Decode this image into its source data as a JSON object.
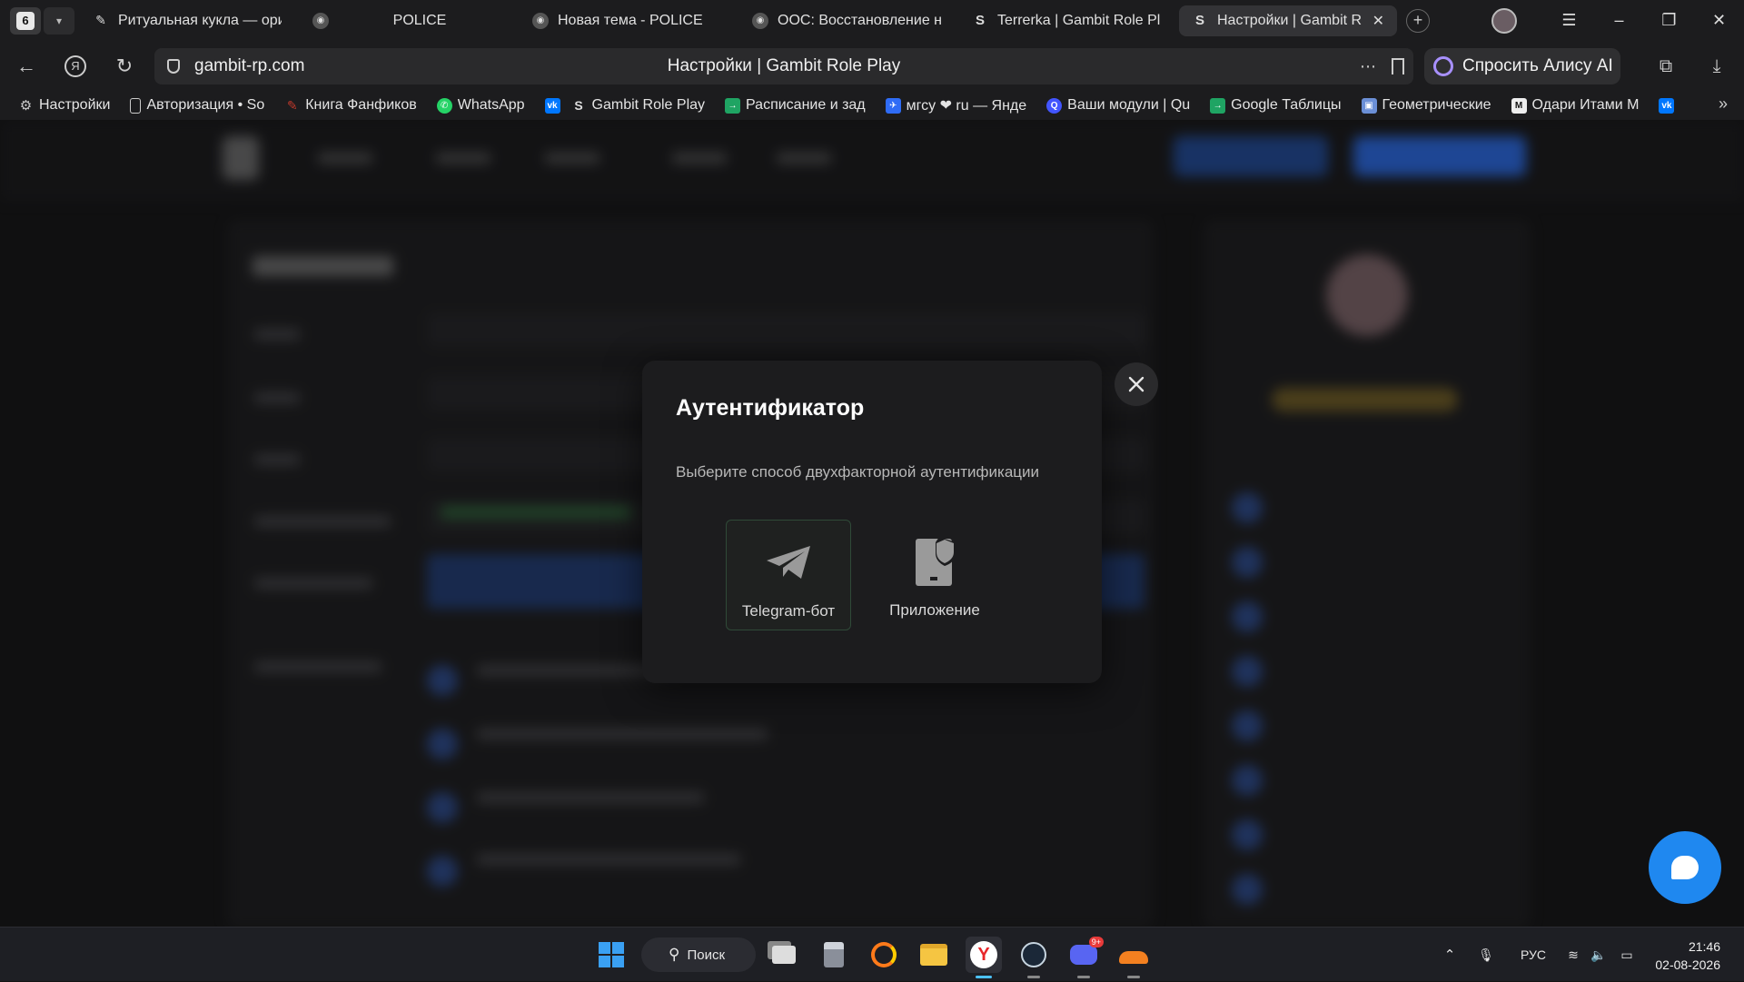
{
  "browser": {
    "tab_count": "6",
    "tabs": [
      {
        "title": "Ритуальная кукла — ориг"
      },
      {
        "title": "POLICE"
      },
      {
        "title": "Новая тема - POLICE"
      },
      {
        "title": "ООС: Восстановление на"
      },
      {
        "title": "Terrerka | Gambit Role Pla"
      },
      {
        "title": "Настройки | Gambit R"
      }
    ],
    "url_host": "gambit-rp.com",
    "page_title": "Настройки | Gambit Role Play",
    "alice_label": "Спросить Алису AI",
    "bookmarks": [
      {
        "label": "Настройки"
      },
      {
        "label": "Авторизация • So"
      },
      {
        "label": "Книга Фанфиков"
      },
      {
        "label": "WhatsApp"
      },
      {
        "label": ""
      },
      {
        "label": "Gambit Role Play"
      },
      {
        "label": "Расписание и зад"
      },
      {
        "label": "мгсу ❤ ru — Янде"
      },
      {
        "label": "Ваши модули | Qu"
      },
      {
        "label": "Google Таблицы"
      },
      {
        "label": "Геометрические"
      },
      {
        "label": "Одари Итами М"
      },
      {
        "label": ""
      }
    ]
  },
  "modal": {
    "title": "Аутентификатор",
    "subtitle": "Выберите способ двухфакторной аутентификации",
    "options": [
      {
        "label": "Telegram-бот",
        "icon": "telegram-icon",
        "selected": true
      },
      {
        "label": "Приложение",
        "icon": "phone-shield-icon",
        "selected": false
      }
    ]
  },
  "taskbar": {
    "search_label": "Поиск",
    "discord_badge": "9+",
    "language": "РУС",
    "time": "21:46",
    "date": "02-08-2026"
  },
  "colors": {
    "accent_blue": "#1f88f0",
    "modal_bg": "#1c1c1e",
    "selected_border": "#2f4a38"
  }
}
